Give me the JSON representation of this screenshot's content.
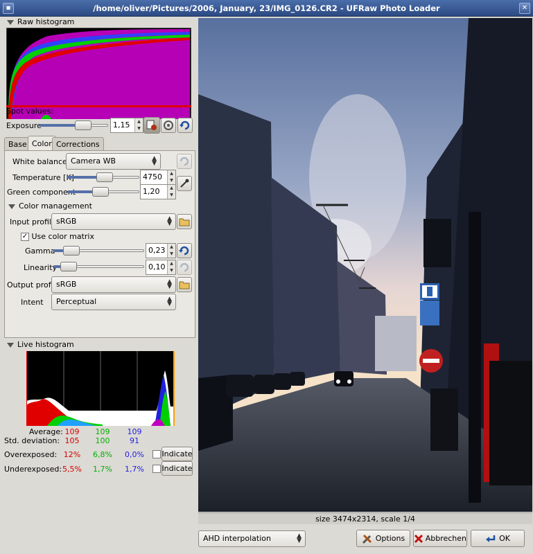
{
  "window": {
    "title": "/home/oliver/Pictures/2006, January, 23/IMG_0126.CR2 - UFRaw Photo Loader"
  },
  "raw_histogram": {
    "label": "Raw histogram",
    "spot_values_label": "Spot values:"
  },
  "exposure": {
    "label": "Exposure",
    "value": "1,15"
  },
  "tabs": [
    {
      "label": "Base"
    },
    {
      "label": "Color"
    },
    {
      "label": "Corrections"
    }
  ],
  "white_balance": {
    "label": "White balance",
    "value": "Camera WB"
  },
  "temperature": {
    "label": "Temperature [K]",
    "value": "4750"
  },
  "green": {
    "label": "Green component",
    "value": "1,20"
  },
  "color_management": {
    "label": "Color management",
    "input_profile_label": "Input profile",
    "input_profile_value": "sRGB",
    "use_matrix_label": "Use color matrix",
    "gamma_label": "Gamma",
    "gamma_value": "0,23",
    "linearity_label": "Linearity",
    "linearity_value": "0,10",
    "output_profile_label": "Output profile",
    "output_profile_value": "sRGB",
    "intent_label": "Intent",
    "intent_value": "Perceptual"
  },
  "live_histogram": {
    "label": "Live histogram",
    "rows": [
      {
        "label": "Average:",
        "r": "109",
        "g": "109",
        "b": "109"
      },
      {
        "label": "Std. deviation:",
        "r": "105",
        "g": "100",
        "b": "91"
      },
      {
        "label": "Overexposed:",
        "r": "12%",
        "g": "6,8%",
        "b": "0,0%",
        "button": "Indicate"
      },
      {
        "label": "Underexposed:",
        "r": "5,5%",
        "g": "1,7%",
        "b": "1,7%",
        "button": "Indicate"
      }
    ]
  },
  "status": {
    "size_text": "size 3474x2314, scale 1/4"
  },
  "bottom": {
    "interpolation": "AHD interpolation",
    "options": "Options",
    "cancel": "Abbrechen",
    "ok": "OK"
  },
  "colors": {
    "title_bar": "#3a5c96",
    "red": "#d40000",
    "green": "#00b000",
    "blue": "#2020e0"
  }
}
